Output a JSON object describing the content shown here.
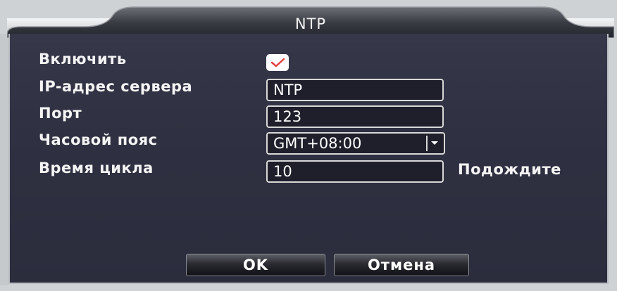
{
  "dialog": {
    "title": "NTP"
  },
  "form": {
    "enable_label": "Включить",
    "enable_checked": true,
    "server_label": "IP-адрес сервера",
    "server_value": "NTP",
    "port_label": "Порт",
    "port_value": "123",
    "timezone_label": "Часовой пояс",
    "timezone_value": "GMT+08:00",
    "cycle_label": "Время цикла",
    "cycle_value": "10",
    "cycle_status": "Подождите"
  },
  "buttons": {
    "ok_label": "OK",
    "cancel_label": "Отмена"
  },
  "colors": {
    "panel": "#2f3142",
    "checkmark": "#e0403c",
    "text": "#f4f4f4"
  },
  "icons": {
    "checkbox": "checkmark-icon",
    "dropdown": "chevron-down-icon"
  }
}
